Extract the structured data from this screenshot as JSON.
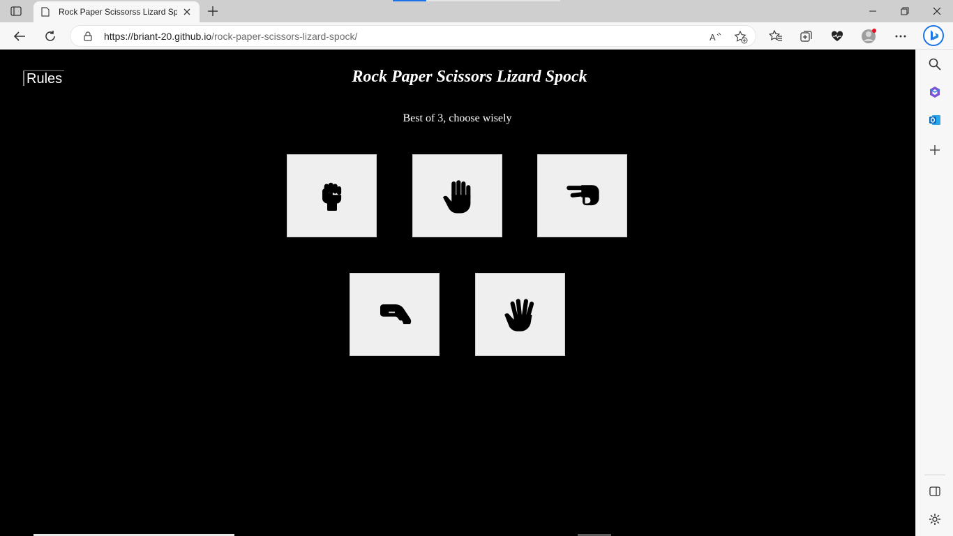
{
  "browser": {
    "tab_title": "Rock Paper Scissorss Lizard Spoc",
    "url_host": "https://briant-20.github.io",
    "url_path": "/rock-paper-scissors-lizard-spock/",
    "accent": "#1a73e8"
  },
  "page": {
    "rules_label": "Rules",
    "title": "Rock Paper Scissors Lizard Spock",
    "subtitle": "Best of 3, choose wisely",
    "choices": [
      {
        "name": "rock",
        "icon": "fist-icon"
      },
      {
        "name": "paper",
        "icon": "open-hand-icon"
      },
      {
        "name": "scissors",
        "icon": "scissors-hand-icon"
      },
      {
        "name": "lizard",
        "icon": "lizard-hand-icon"
      },
      {
        "name": "spock",
        "icon": "spock-hand-icon"
      }
    ]
  }
}
